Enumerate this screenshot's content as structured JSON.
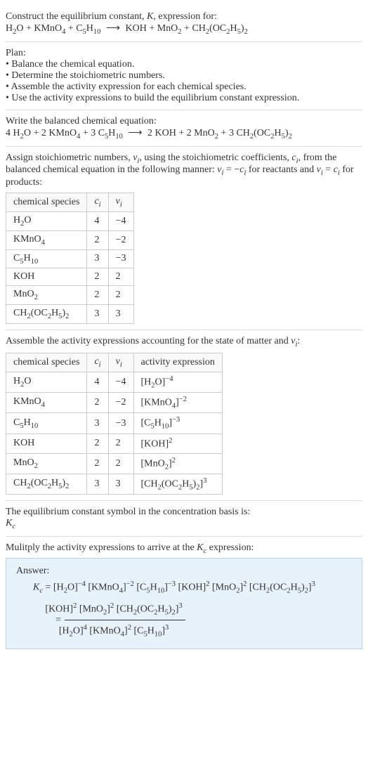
{
  "intro": {
    "line1_pre": "Construct the equilibrium constant, ",
    "line1_k": "K",
    "line1_post": ", expression for:",
    "eq_lhs1": "H",
    "eq_lhs1_s": "2",
    "eq_lhs2": "O + KMnO",
    "eq_lhs2_s": "4",
    "eq_lhs3": " + C",
    "eq_lhs3_s": "5",
    "eq_lhs4": "H",
    "eq_lhs4_s": "10",
    "arrow": " ⟶ ",
    "eq_rhs1": "KOH + MnO",
    "eq_rhs1_s": "2",
    "eq_rhs2": " + CH",
    "eq_rhs2_s": "2",
    "eq_rhs3": "(OC",
    "eq_rhs3_s": "2",
    "eq_rhs4": "H",
    "eq_rhs4_s": "5",
    "eq_rhs5": ")",
    "eq_rhs5_s": "2"
  },
  "plan": {
    "title": "Plan:",
    "b1": "• Balance the chemical equation.",
    "b2": "• Determine the stoichiometric numbers.",
    "b3": "• Assemble the activity expression for each chemical species.",
    "b4": "• Use the activity expressions to build the equilibrium constant expression."
  },
  "balanced": {
    "title": "Write the balanced chemical equation:",
    "c1": "4 H",
    "c1s": "2",
    "c2": "O + 2 KMnO",
    "c2s": "4",
    "c3": " + 3 C",
    "c3s": "5",
    "c4": "H",
    "c4s": "10",
    "arrow": " ⟶ ",
    "c5": "2 KOH + 2 MnO",
    "c5s": "2",
    "c6": " + 3 CH",
    "c6s": "2",
    "c7": "(OC",
    "c7s": "2",
    "c8": "H",
    "c8s": "5",
    "c9": ")",
    "c9s": "2"
  },
  "assign": {
    "p1": "Assign stoichiometric numbers, ",
    "nu": "ν",
    "i": "i",
    "p2": ", using the stoichiometric coefficients, ",
    "c": "c",
    "p3": ", from the balanced chemical equation in the following manner: ",
    "eq1a": "ν",
    "eq1b": " = −",
    "eq1c": "c",
    "p4": " for reactants and ",
    "eq2a": "ν",
    "eq2b": " = ",
    "eq2c": "c",
    "p5": " for products:"
  },
  "table1": {
    "h1": "chemical species",
    "h2": "c",
    "h2s": "i",
    "h3": "ν",
    "h3s": "i",
    "r1": {
      "sp_a": "H",
      "sp_as": "2",
      "sp_b": "O",
      "c": "4",
      "v": "−4"
    },
    "r2": {
      "sp_a": "KMnO",
      "sp_as": "4",
      "sp_b": "",
      "c": "2",
      "v": "−2"
    },
    "r3": {
      "sp_a": "C",
      "sp_as": "5",
      "sp_b": "H",
      "sp_bs": "10",
      "c": "3",
      "v": "−3"
    },
    "r4": {
      "sp_a": "KOH",
      "c": "2",
      "v": "2"
    },
    "r5": {
      "sp_a": "MnO",
      "sp_as": "2",
      "c": "2",
      "v": "2"
    },
    "r6": {
      "sp_a": "CH",
      "sp_as": "2",
      "sp_b": "(OC",
      "sp_bs": "2",
      "sp_c": "H",
      "sp_cs": "5",
      "sp_d": ")",
      "sp_ds": "2",
      "c": "3",
      "v": "3"
    }
  },
  "assemble": {
    "p1": "Assemble the activity expressions accounting for the state of matter and ",
    "nu": "ν",
    "i": "i",
    "p2": ":"
  },
  "table2": {
    "h1": "chemical species",
    "h2": "c",
    "h2s": "i",
    "h3": "ν",
    "h3s": "i",
    "h4": "activity expression",
    "r1": {
      "c": "4",
      "v": "−4",
      "ae_a": "[H",
      "ae_as": "2",
      "ae_b": "O]",
      "ae_exp": "−4"
    },
    "r2": {
      "c": "2",
      "v": "−2",
      "ae_a": "[KMnO",
      "ae_as": "4",
      "ae_b": "]",
      "ae_exp": "−2"
    },
    "r3": {
      "c": "3",
      "v": "−3",
      "ae_a": "[C",
      "ae_as": "5",
      "ae_b": "H",
      "ae_bs": "10",
      "ae_c": "]",
      "ae_exp": "−3"
    },
    "r4": {
      "c": "2",
      "v": "2",
      "ae_a": "[KOH]",
      "ae_exp": "2"
    },
    "r5": {
      "c": "2",
      "v": "2",
      "ae_a": "[MnO",
      "ae_as": "2",
      "ae_b": "]",
      "ae_exp": "2"
    },
    "r6": {
      "c": "3",
      "v": "3",
      "ae_a": "[CH",
      "ae_as": "2",
      "ae_b": "(OC",
      "ae_bs": "2",
      "ae_c": "H",
      "ae_cs": "5",
      "ae_d": ")",
      "ae_ds": "2",
      "ae_e": "]",
      "ae_exp": "3"
    }
  },
  "symbol": {
    "line1": "The equilibrium constant symbol in the concentration basis is:",
    "k": "K",
    "ks": "c"
  },
  "multiply": {
    "p1": "Mulitply the activity expressions to arrive at the ",
    "k": "K",
    "ks": "c",
    "p2": " expression:"
  },
  "answer": {
    "title": "Answer:",
    "lhs_k": "K",
    "lhs_ks": "c",
    "eq": " = ",
    "t1": "[H",
    "t1s": "2",
    "t1b": "O]",
    "t1e": "−4",
    "t2": " [KMnO",
    "t2s": "4",
    "t2b": "]",
    "t2e": "−2",
    "t3": " [C",
    "t3s": "5",
    "t3b": "H",
    "t3bs": "10",
    "t3c": "]",
    "t3e": "−3",
    "t4": " [KOH]",
    "t4e": "2",
    "t5": " [MnO",
    "t5s": "2",
    "t5b": "]",
    "t5e": "2",
    "t6": " [CH",
    "t6s": "2",
    "t6b": "(OC",
    "t6bs": "2",
    "t6c": "H",
    "t6cs": "5",
    "t6d": ")",
    "t6ds": "2",
    "t6e": "]",
    "t6ee": "3",
    "eq2": " = ",
    "num1": "[KOH]",
    "num1e": "2",
    "num2": " [MnO",
    "num2s": "2",
    "num2b": "]",
    "num2e": "2",
    "num3": " [CH",
    "num3s": "2",
    "num3b": "(OC",
    "num3bs": "2",
    "num3c": "H",
    "num3cs": "5",
    "num3d": ")",
    "num3ds": "2",
    "num3e": "]",
    "num3ee": "3",
    "den1": "[H",
    "den1s": "2",
    "den1b": "O]",
    "den1e": "4",
    "den2": " [KMnO",
    "den2s": "4",
    "den2b": "]",
    "den2e": "2",
    "den3": " [C",
    "den3s": "5",
    "den3b": "H",
    "den3bs": "10",
    "den3c": "]",
    "den3e": "3"
  }
}
